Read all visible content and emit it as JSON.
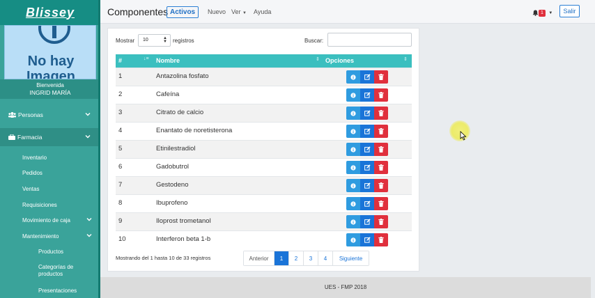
{
  "sidebar": {
    "brand": "Blissey",
    "no_image_line1": "No hay",
    "no_image_line2": "Imagen",
    "welcome": "Bienvenida",
    "user_name": "INGRID MARÍA",
    "menu": [
      {
        "label": "Personas",
        "icon": "users-icon"
      },
      {
        "label": "Farmacia",
        "icon": "briefcase-icon"
      }
    ],
    "farmacia_items": [
      "Inventario",
      "Pedidos",
      "Ventas",
      "Requisiciones",
      "Movimiento de caja",
      "Mantenimiento"
    ],
    "mantenimiento_items": [
      "Productos",
      "Categorías de productos",
      "Presentaciones"
    ],
    "colors": {
      "sidebar_bg": "#3aa39a",
      "brand_bg": "#168d84"
    }
  },
  "topbar": {
    "title": "Componentes",
    "badge": "Activos",
    "nav": [
      "Nuevo",
      "Ver",
      "Ayuda"
    ],
    "notif_count": "1",
    "logout": "Salir"
  },
  "table_controls": {
    "show_label": "Mostrar",
    "page_size": "10",
    "records_label": "registros",
    "search_label": "Buscar:",
    "search_value": ""
  },
  "table": {
    "headers": [
      "#",
      "Nombre",
      "Opciones"
    ],
    "rows": [
      {
        "n": "1",
        "name": "Antazolina fosfato"
      },
      {
        "n": "2",
        "name": "Cafeína"
      },
      {
        "n": "3",
        "name": "Citrato de calcio"
      },
      {
        "n": "4",
        "name": "Enantato de noretisterona"
      },
      {
        "n": "5",
        "name": "Etinilestradiol"
      },
      {
        "n": "6",
        "name": "Gadobutrol"
      },
      {
        "n": "7",
        "name": "Gestodeno"
      },
      {
        "n": "8",
        "name": "Ibuprofeno"
      },
      {
        "n": "9",
        "name": "Iloprost trometanol"
      },
      {
        "n": "10",
        "name": "Interferon beta 1-b"
      }
    ],
    "row_actions": [
      "info-icon",
      "edit-icon",
      "trash-icon"
    ],
    "header_color": "#3bbfbf"
  },
  "pagination": {
    "info": "Mostrando del 1 hasta 10 de 33 registros",
    "prev": "Anterior",
    "pages": [
      "1",
      "2",
      "3",
      "4"
    ],
    "current": "1",
    "next": "Siguiente"
  },
  "footer": {
    "text": "UES - FMP 2018"
  }
}
